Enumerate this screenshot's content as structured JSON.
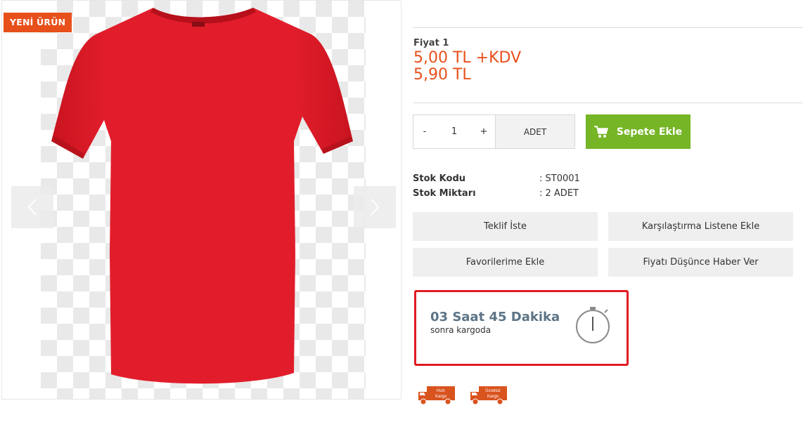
{
  "product": {
    "badge": "YENİ ÜRÜN",
    "image_alt": "red t-shirt"
  },
  "gallery": {
    "prev_icon": "chevron-left-icon",
    "next_icon": "chevron-right-icon"
  },
  "price": {
    "label": "Fiyat 1",
    "net": "5,00 TL +KDV",
    "gross": "5,90 TL"
  },
  "quantity": {
    "minus": "-",
    "value": "1",
    "plus": "+",
    "unit": "ADET"
  },
  "cart": {
    "label": "Sepete Ekle",
    "icon": "shopping-cart-icon"
  },
  "specs": [
    {
      "key": "Stok Kodu",
      "value": ": ST0001"
    },
    {
      "key": "Stok Miktarı",
      "value": ": 2 ADET"
    }
  ],
  "actions": {
    "quote": "Teklif İste",
    "compare": "Karşılaştırma Listene Ekle",
    "favorites": "Favorilerime Ekle",
    "price_alert": "Fiyatı Düşünce Haber Ver"
  },
  "shipping": {
    "countdown": "03 Saat 45 Dakika",
    "note": "sonra kargoda",
    "icon": "stopwatch-icon"
  },
  "shipping_badges": [
    {
      "line1": "Hızlı",
      "line2": "Kargo"
    },
    {
      "line1": "Ücretsiz",
      "line2": "Kargo"
    }
  ],
  "colors": {
    "accent": "#e8501b",
    "cart_green": "#76b526",
    "shirt_red": "#e01e2c",
    "alert_red": "#e11b22"
  }
}
